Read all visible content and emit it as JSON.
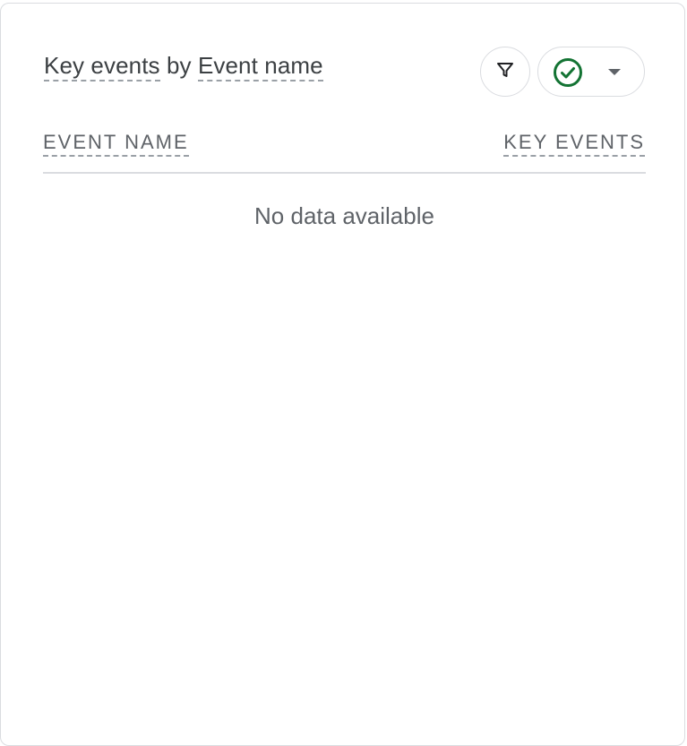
{
  "card": {
    "title_part1": "Key events",
    "title_by": " by ",
    "title_part2": "Event name"
  },
  "controls": {
    "filter_icon": "filter-icon",
    "status_icon": "check-circle-icon",
    "status_color": "#137333",
    "dropdown_icon": "caret-down-icon"
  },
  "table": {
    "columns": [
      "EVENT NAME",
      "KEY EVENTS"
    ],
    "empty_message": "No data available"
  }
}
